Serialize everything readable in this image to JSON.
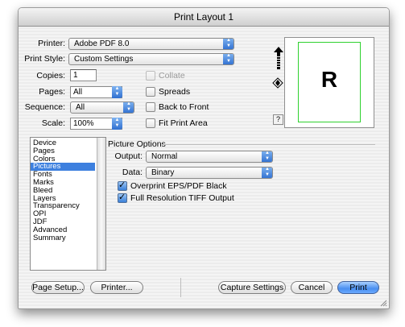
{
  "window": {
    "title": "Print Layout 1"
  },
  "fields": {
    "printer": {
      "label": "Printer:",
      "value": "Adobe PDF 8.0"
    },
    "print_style": {
      "label": "Print Style:",
      "value": "Custom Settings"
    },
    "copies": {
      "label": "Copies:",
      "value": "1"
    },
    "pages": {
      "label": "Pages:",
      "value": "All"
    },
    "sequence": {
      "label": "Sequence:",
      "value": "All"
    },
    "scale": {
      "label": "Scale:",
      "value": "100%"
    }
  },
  "options": {
    "collate": {
      "label": "Collate",
      "checked": false,
      "enabled": false
    },
    "spreads": {
      "label": "Spreads",
      "checked": false
    },
    "back_to_front": {
      "label": "Back to Front",
      "checked": false
    },
    "fit_print_area": {
      "label": "Fit Print Area",
      "checked": false
    }
  },
  "preview": {
    "letter": "R",
    "help_label": "?"
  },
  "panel_list": {
    "items": [
      "Device",
      "Pages",
      "Colors",
      "Pictures",
      "Fonts",
      "Marks",
      "Bleed",
      "Layers",
      "Transparency",
      "OPI",
      "JDF",
      "Advanced",
      "Summary"
    ],
    "selected": "Pictures"
  },
  "picture_options": {
    "title": "Picture Options",
    "output": {
      "label": "Output:",
      "value": "Normal"
    },
    "data": {
      "label": "Data:",
      "value": "Binary"
    },
    "overprint": {
      "label": "Overprint EPS/PDF Black",
      "checked": true
    },
    "full_res": {
      "label": "Full Resolution TIFF Output",
      "checked": true
    }
  },
  "buttons": {
    "page_setup": "Page Setup...",
    "printer": "Printer...",
    "capture": "Capture Settings",
    "cancel": "Cancel",
    "print": "Print"
  },
  "colors": {
    "accent": "#3d80df",
    "preview_border": "#2fd12f"
  }
}
